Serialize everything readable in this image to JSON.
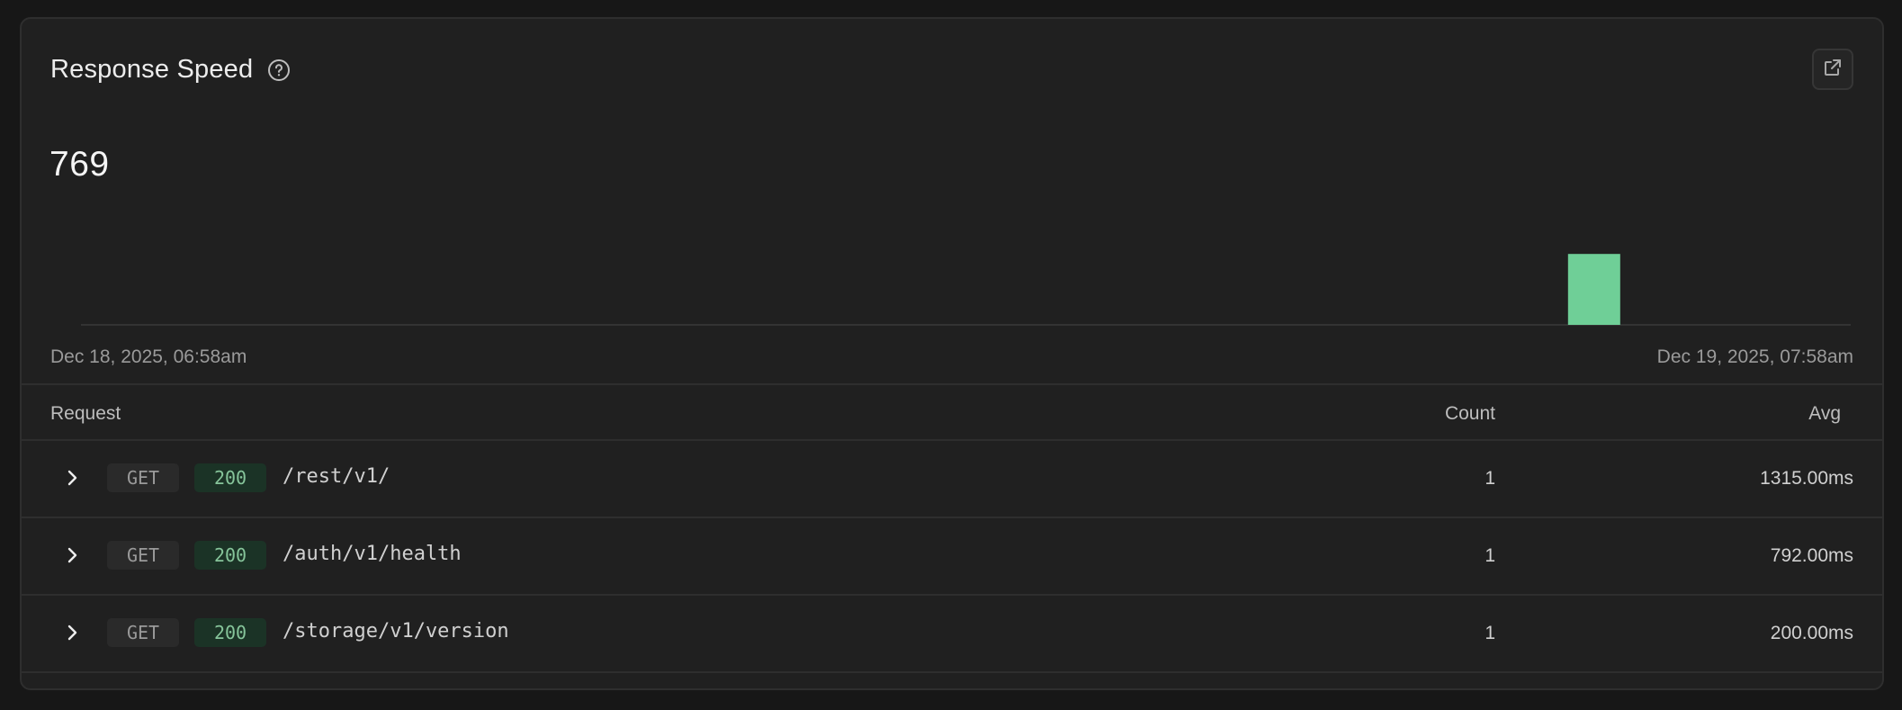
{
  "card": {
    "title": "Response Speed",
    "help_icon": "question-circle-icon",
    "external_icon": "external-link-icon",
    "value": "769"
  },
  "chart_data": {
    "type": "bar",
    "bars": [
      {
        "position": 0.855,
        "value": 1
      }
    ],
    "x_start_label": "Dec 18, 2025, 06:58am",
    "x_end_label": "Dec 19, 2025, 07:58am",
    "bar_color": "#6fcf97",
    "ylim": [
      0,
      1.65
    ]
  },
  "table": {
    "headers": {
      "request": "Request",
      "count": "Count",
      "avg": "Avg"
    },
    "rows": [
      {
        "method": "GET",
        "status": "200",
        "path": "/rest/v1/",
        "count": "1",
        "avg": "1315.00ms"
      },
      {
        "method": "GET",
        "status": "200",
        "path": "/auth/v1/health",
        "count": "1",
        "avg": "792.00ms"
      },
      {
        "method": "GET",
        "status": "200",
        "path": "/storage/v1/version",
        "count": "1",
        "avg": "200.00ms"
      }
    ]
  },
  "colors": {
    "background": "#171717",
    "card": "#202020",
    "accent_green": "#6fcf97"
  }
}
